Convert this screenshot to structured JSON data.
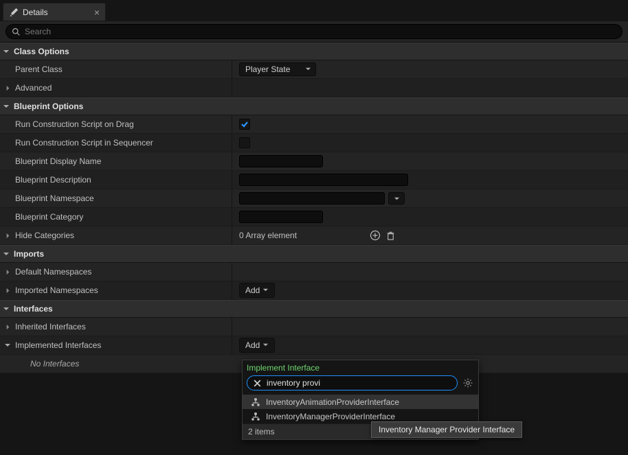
{
  "tab": {
    "title": "Details"
  },
  "search": {
    "placeholder": "Search"
  },
  "sections": {
    "class_options": {
      "title": "Class Options"
    },
    "blueprint_options": {
      "title": "Blueprint Options"
    },
    "imports": {
      "title": "Imports"
    },
    "interfaces": {
      "title": "Interfaces"
    }
  },
  "rows": {
    "parent_class": {
      "label": "Parent Class",
      "value": "Player State"
    },
    "advanced": {
      "label": "Advanced"
    },
    "run_drag": {
      "label": "Run Construction Script on Drag",
      "checked": true
    },
    "run_seq": {
      "label": "Run Construction Script in Sequencer",
      "checked": false
    },
    "bp_display_name": {
      "label": "Blueprint Display Name",
      "value": ""
    },
    "bp_description": {
      "label": "Blueprint Description",
      "value": ""
    },
    "bp_namespace": {
      "label": "Blueprint Namespace",
      "value": ""
    },
    "bp_category": {
      "label": "Blueprint Category",
      "value": ""
    },
    "hide_categories": {
      "label": "Hide Categories",
      "summary": "0 Array element"
    },
    "default_namespaces": {
      "label": "Default Namespaces"
    },
    "imported_namespaces": {
      "label": "Imported Namespaces",
      "add_label": "Add"
    },
    "inherited_interfaces": {
      "label": "Inherited Interfaces"
    },
    "implemented_interfaces": {
      "label": "Implemented Interfaces",
      "add_label": "Add"
    },
    "no_interfaces": {
      "label": "No Interfaces"
    }
  },
  "popup": {
    "title": "Implement Interface",
    "search_value": "inventory provi",
    "items": [
      {
        "label": "InventoryAnimationProviderInterface"
      },
      {
        "label": "InventoryManagerProviderInterface"
      }
    ],
    "footer": "2 items"
  },
  "tooltip": {
    "text": "Inventory Manager Provider Interface"
  }
}
